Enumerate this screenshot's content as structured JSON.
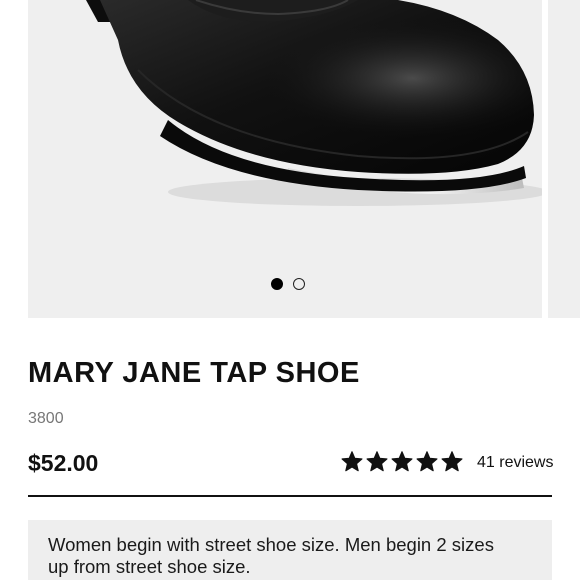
{
  "gallery": {
    "image_alt": "Black Mary Jane tap shoe",
    "slide_count": 2,
    "active_slide": 1
  },
  "product": {
    "title": "MARY JANE TAP SHOE",
    "sku": "3800",
    "price": "$52.00",
    "rating": 5,
    "rating_max": 5,
    "reviews_label": "41 reviews"
  },
  "size_note": "Women begin with street shoe size. Men begin 2 sizes up from street shoe size.",
  "colors": {
    "image_bg": "#efefef",
    "note_bg": "#eeeeee",
    "text": "#111111",
    "sku_text": "#777777"
  },
  "icons": {
    "star": "star-icon",
    "dot_active": "carousel-dot-active",
    "dot_inactive": "carousel-dot-inactive"
  }
}
